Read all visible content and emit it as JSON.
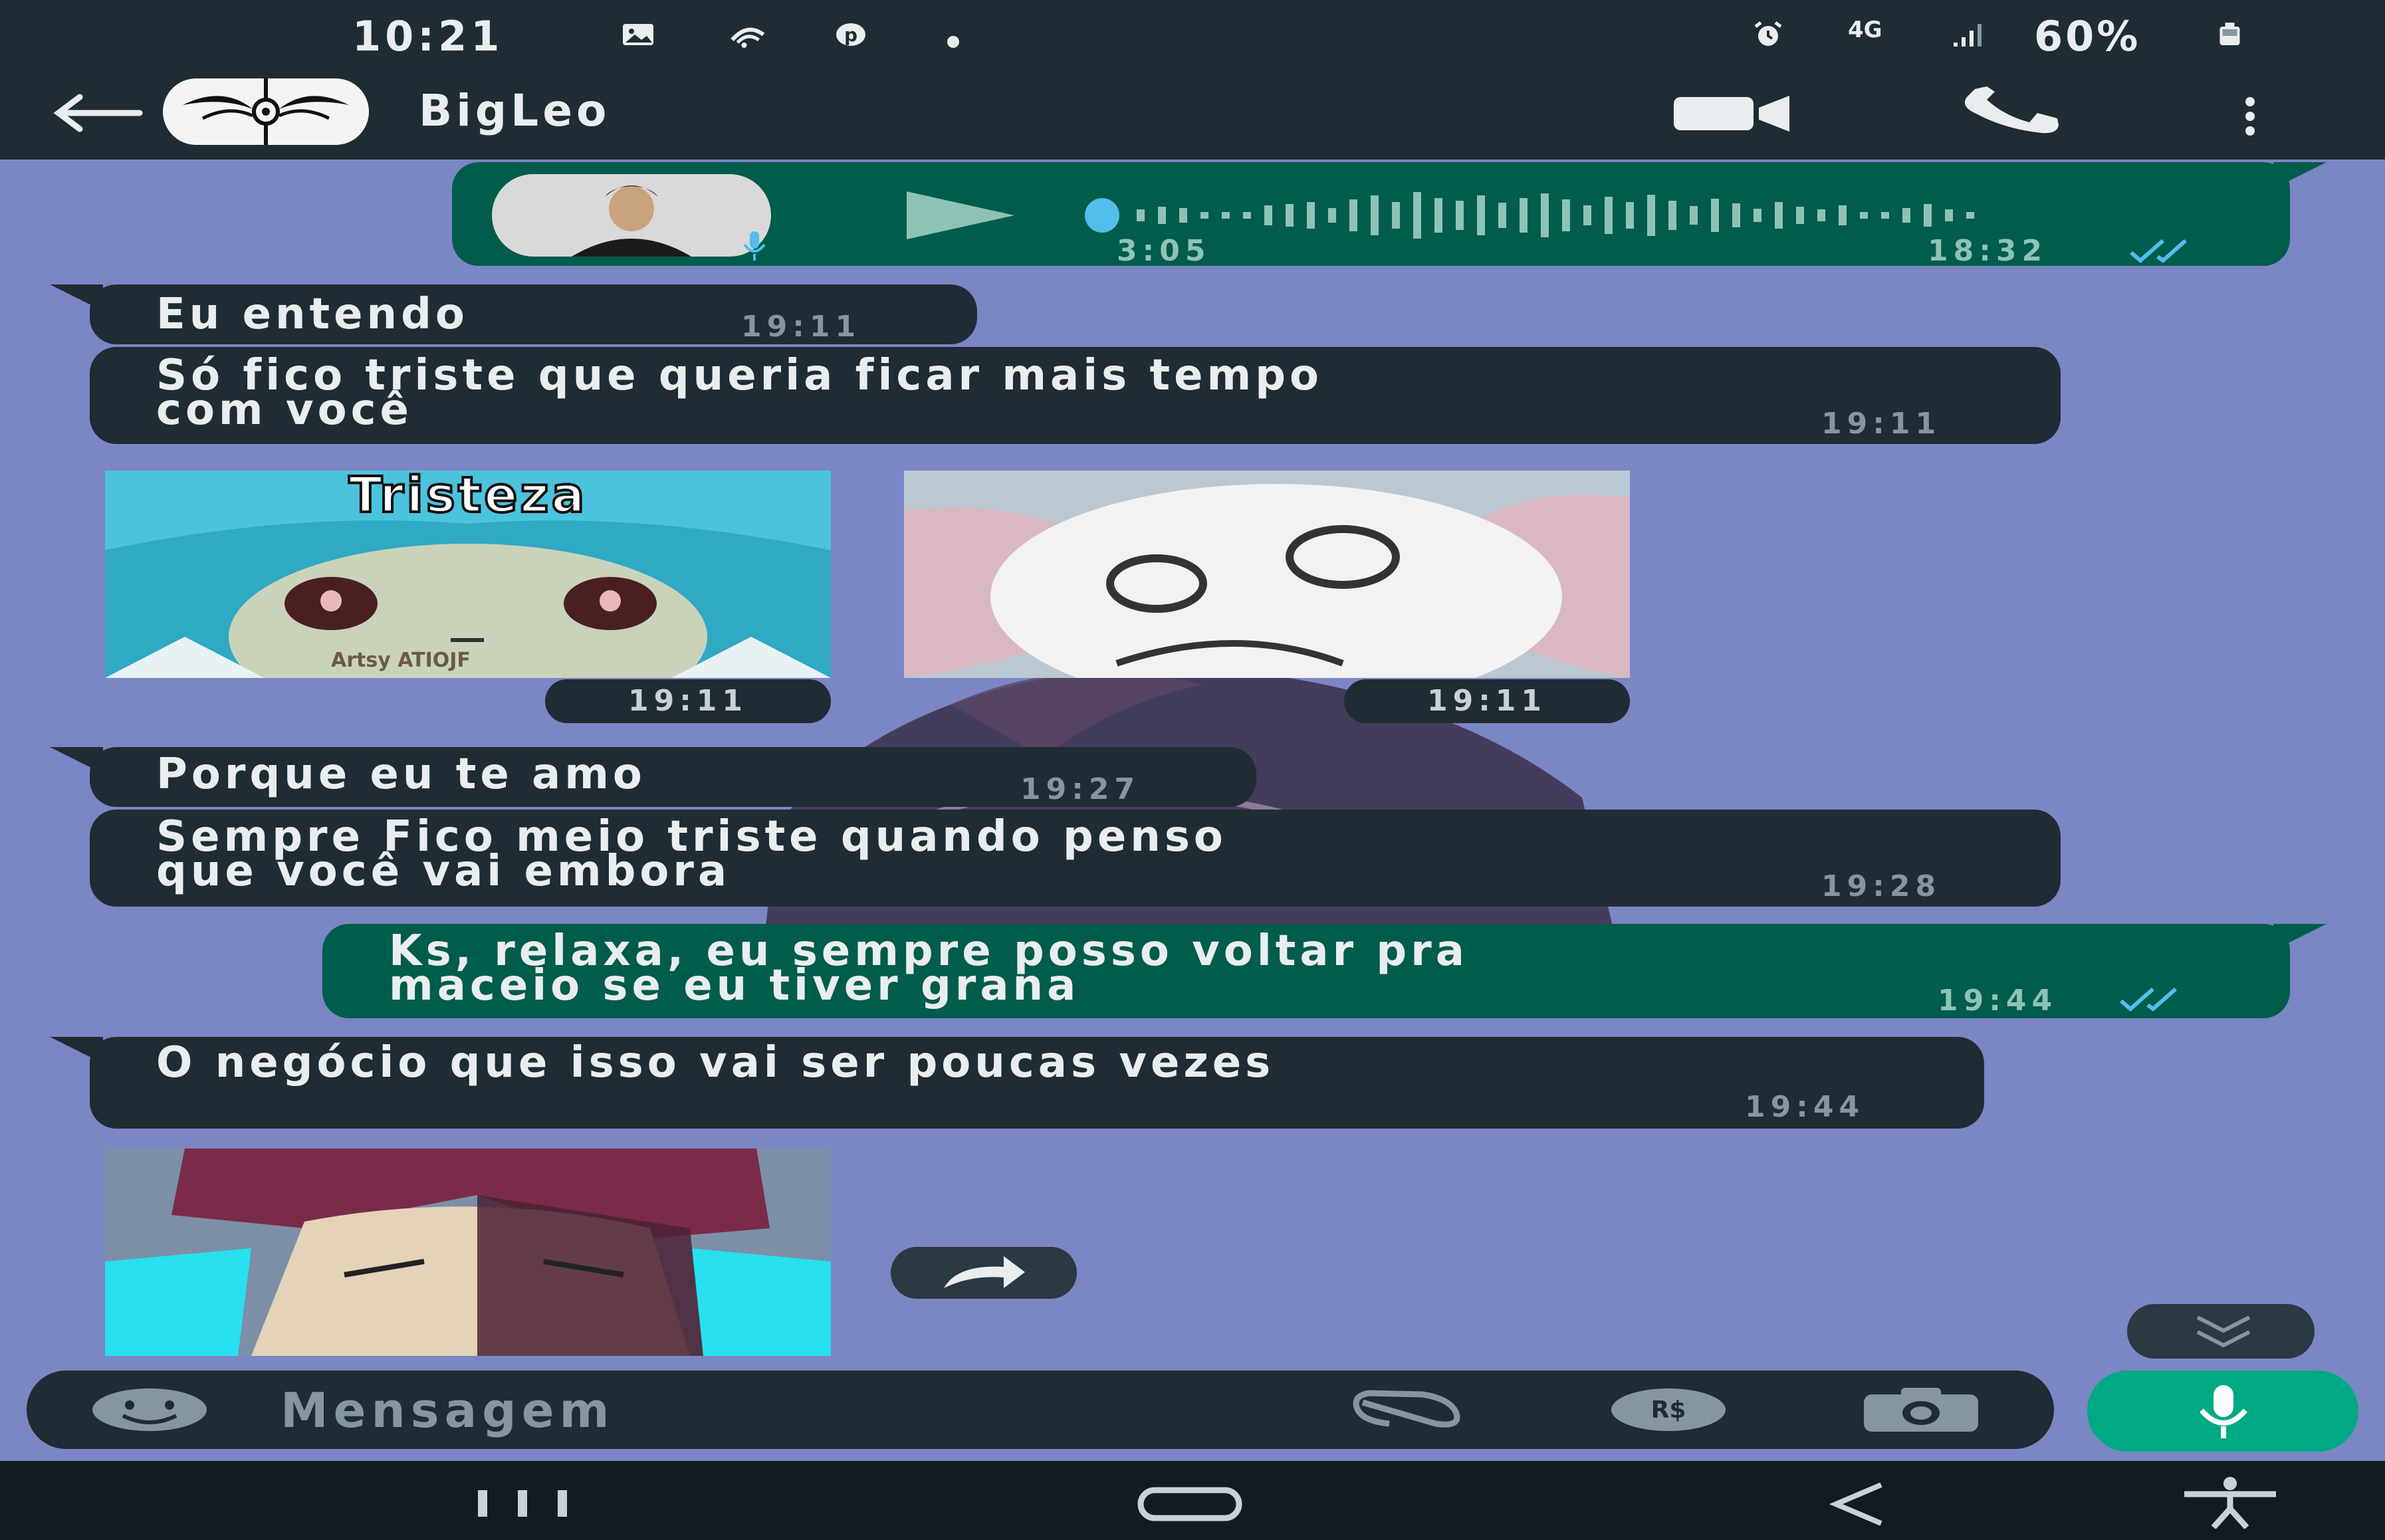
{
  "status_bar": {
    "time": "10:21",
    "network": "4G",
    "battery": "60%",
    "icons": [
      "gallery-icon",
      "cast-icon",
      "pinterest-icon",
      "dot-icon",
      "alarm-icon",
      "network-4g-icon",
      "signal-icon",
      "battery-icon"
    ]
  },
  "header": {
    "contact_name": "BigLeo",
    "icons": [
      "back-arrow-icon",
      "avatar",
      "video-call-icon",
      "phone-icon",
      "more-vert-icon"
    ]
  },
  "messages": [
    {
      "type": "voice",
      "direction": "out",
      "duration": "3:05",
      "time": "18:32",
      "read": true
    },
    {
      "type": "text",
      "direction": "in",
      "text": "Eu entendo",
      "time": "19:11"
    },
    {
      "type": "text",
      "direction": "in",
      "lines": [
        "Só fico triste que queria ficar mais tempo",
        "com você"
      ],
      "time": "19:11"
    },
    {
      "type": "sticker",
      "direction": "in",
      "caption": "Tristeza",
      "watermark": "Artsy ATIOJF",
      "time": "19:11"
    },
    {
      "type": "sticker",
      "direction": "in",
      "time": "19:11"
    },
    {
      "type": "text",
      "direction": "in",
      "text": "Porque eu te amo",
      "time": "19:27"
    },
    {
      "type": "text",
      "direction": "in",
      "lines": [
        "Sempre Fico meio triste quando penso",
        "que você vai embora"
      ],
      "time": "19:28"
    },
    {
      "type": "text",
      "direction": "out",
      "lines": [
        "Ks, relaxa, eu sempre posso voltar pra",
        "maceio se eu tiver grana"
      ],
      "time": "19:44",
      "read": true
    },
    {
      "type": "text",
      "direction": "in",
      "text": "O negócio que isso vai ser poucas vezes",
      "time": "19:44"
    },
    {
      "type": "sticker",
      "direction": "in"
    }
  ],
  "input": {
    "placeholder": "Mensagem",
    "icons": [
      "emoji-icon",
      "attach-icon",
      "payment-icon",
      "camera-icon",
      "mic-icon"
    ]
  },
  "colors": {
    "wallpaper": "#7b86c4",
    "incoming_bubble": "#1f2c34",
    "outgoing_bubble": "#005c4b",
    "accent": "#00a884",
    "read_ticks": "#53bdeb"
  }
}
